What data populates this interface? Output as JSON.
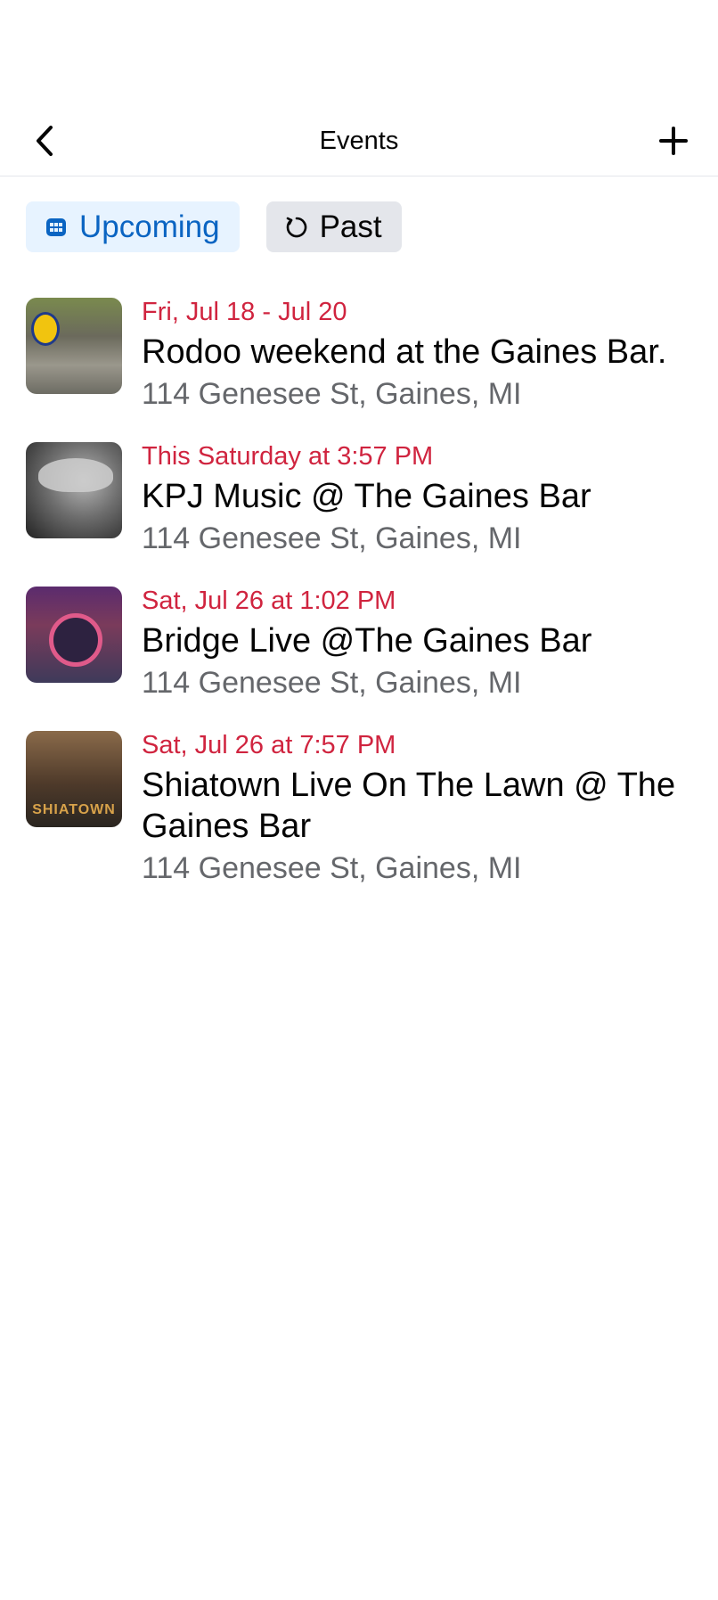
{
  "header": {
    "title": "Events",
    "back_icon": "chevron-left-icon",
    "add_icon": "plus-icon"
  },
  "tabs": [
    {
      "label": "Upcoming",
      "icon": "calendar-icon",
      "active": true
    },
    {
      "label": "Past",
      "icon": "history-icon",
      "active": false
    }
  ],
  "events": [
    {
      "date": "Fri, Jul 18 - Jul 20",
      "name": "Rodoo weekend at the Gaines Bar.",
      "address": "114 Genesee St, Gaines, MI"
    },
    {
      "date": "This Saturday at 3:57 PM",
      "name": "KPJ Music @ The Gaines Bar",
      "address": "114 Genesee St, Gaines, MI"
    },
    {
      "date": "Sat, Jul 26 at 1:02 PM",
      "name": "Bridge Live @The Gaines Bar",
      "address": "114 Genesee St, Gaines, MI"
    },
    {
      "date": "Sat, Jul 26 at 7:57 PM",
      "name": "Shiatown Live On The Lawn @ The Gaines Bar",
      "address": "114 Genesee St, Gaines, MI",
      "thumb_text": "SHIATOWN"
    }
  ],
  "colors": {
    "accent": "#0a64c2",
    "accent_bg": "#e7f3ff",
    "date_red": "#d0243f",
    "secondary_text": "#65676b"
  }
}
